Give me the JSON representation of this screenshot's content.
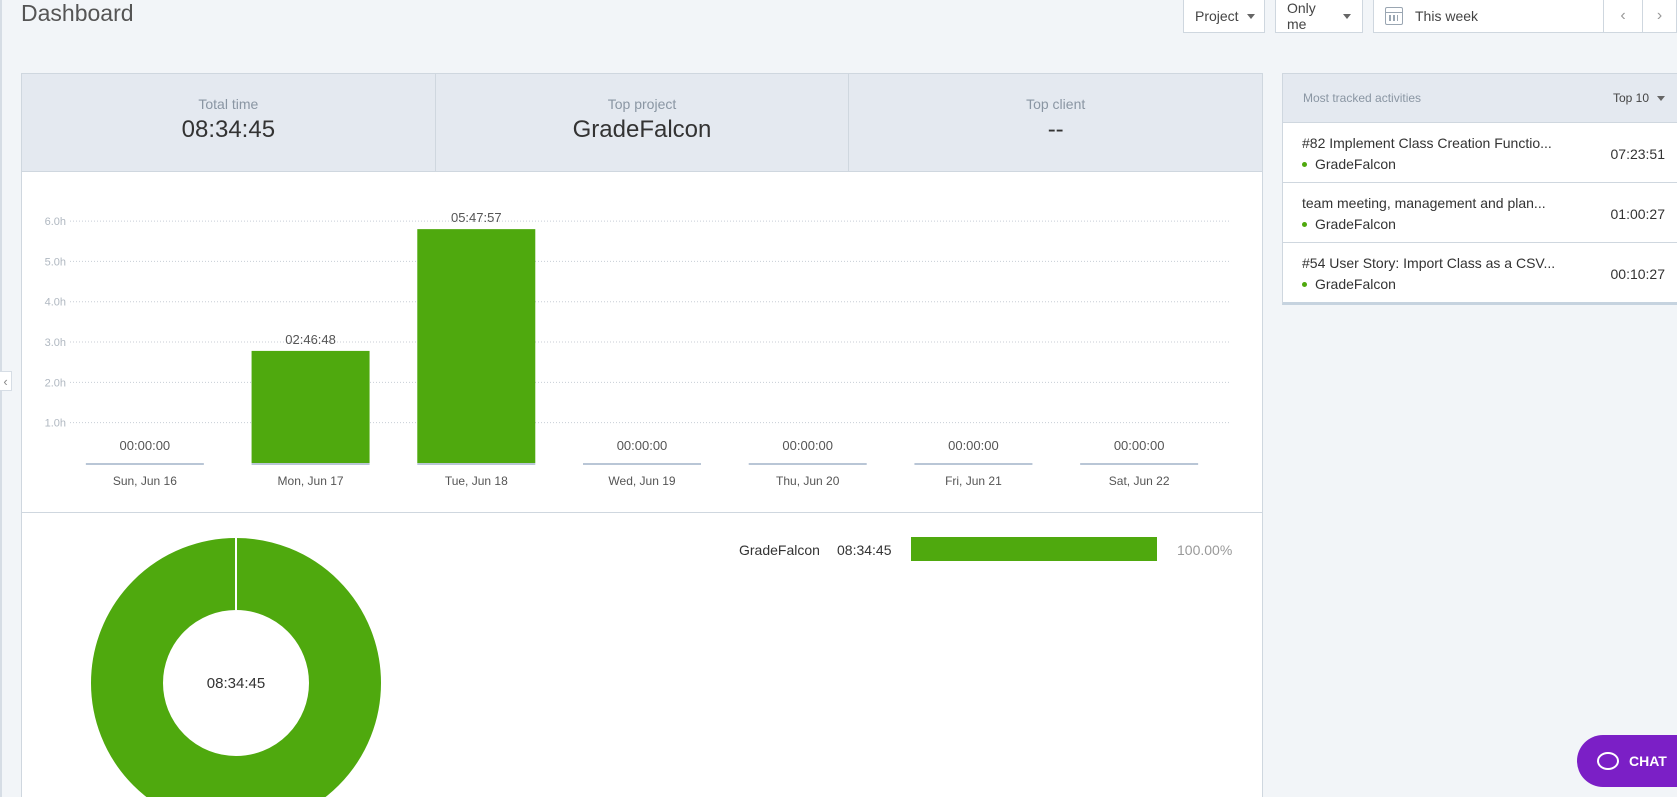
{
  "page": {
    "title": "Dashboard"
  },
  "toolbar": {
    "project_label": "Project",
    "user_filter_label": "Only me",
    "date_range_label": "This week",
    "prev_symbol": "‹",
    "next_symbol": "›"
  },
  "summary": {
    "total_time_label": "Total time",
    "total_time_value": "08:34:45",
    "top_project_label": "Top project",
    "top_project_value": "GradeFalcon",
    "top_client_label": "Top client",
    "top_client_value": "--"
  },
  "chart_data": [
    {
      "type": "bar",
      "categories": [
        "Sun, Jun 16",
        "Mon, Jun 17",
        "Tue, Jun 18",
        "Wed, Jun 19",
        "Thu, Jun 20",
        "Fri, Jun 21",
        "Sat, Jun 22"
      ],
      "values": [
        0,
        2.78,
        5.8,
        0,
        0,
        0,
        0
      ],
      "data_labels": [
        "00:00:00",
        "02:46:48",
        "05:47:57",
        "00:00:00",
        "00:00:00",
        "00:00:00",
        "00:00:00"
      ],
      "y_ticks": [
        "1.0h",
        "2.0h",
        "3.0h",
        "4.0h",
        "5.0h",
        "6.0h"
      ],
      "ylim": [
        0,
        6.2
      ],
      "grid": true,
      "color": "#4fa90e"
    },
    {
      "type": "pie",
      "categories": [
        "GradeFalcon"
      ],
      "values": [
        100.0
      ],
      "center_label": "08:34:45",
      "color": "#4fa90e"
    }
  ],
  "project_breakdown": [
    {
      "name": "GradeFalcon",
      "time": "08:34:45",
      "percent": "100.00%",
      "fraction": 1.0
    }
  ],
  "activities": {
    "header": "Most tracked activities",
    "limit_label": "Top 10",
    "items": [
      {
        "title": "#82 Implement Class Creation Functio...",
        "project": "GradeFalcon",
        "time": "07:23:51"
      },
      {
        "title": "team meeting, management and plan...",
        "project": "GradeFalcon",
        "time": "01:00:27"
      },
      {
        "title": "#54 User Story: Import Class as a CSV...",
        "project": "GradeFalcon",
        "time": "00:10:27"
      }
    ]
  },
  "chat": {
    "label": "CHAT"
  },
  "colors": {
    "accent": "#4fa90e",
    "chat": "#7b1fc6"
  }
}
